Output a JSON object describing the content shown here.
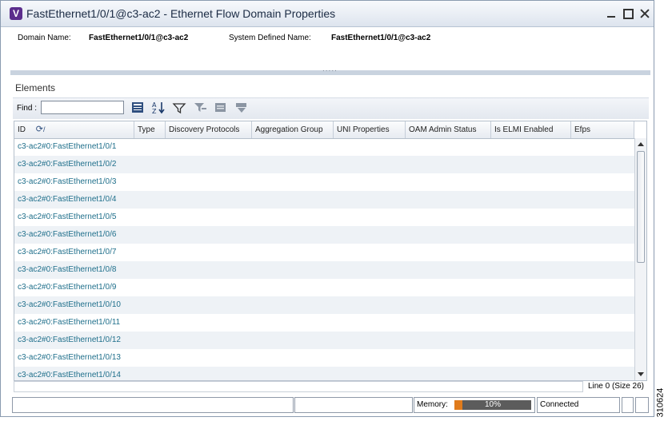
{
  "window": {
    "app_icon_letter": "V",
    "title": "FastEthernet1/0/1@c3-ac2 - Ethernet Flow Domain Properties"
  },
  "properties": {
    "domain_name_label": "Domain Name:",
    "domain_name_value": "FastEthernet1/0/1@c3-ac2",
    "system_name_label": "System Defined Name:",
    "system_name_value": "FastEthernet1/0/1@c3-ac2"
  },
  "elements": {
    "label": "Elements",
    "find_label": "Find :",
    "find_value": "",
    "toolbar_icons": [
      "export-icon",
      "sort-icon",
      "filter-icon",
      "advanced-filter-icon",
      "clear-filter-icon",
      "filter-options-icon"
    ],
    "columns": [
      "ID",
      "Type",
      "Discovery Protocols",
      "Aggregation Group",
      "UNI Properties",
      "OAM Admin Status",
      "Is ELMI Enabled",
      "Efps"
    ],
    "rows": [
      "c3-ac2#0:FastEthernet1/0/1",
      "c3-ac2#0:FastEthernet1/0/2",
      "c3-ac2#0:FastEthernet1/0/3",
      "c3-ac2#0:FastEthernet1/0/4",
      "c3-ac2#0:FastEthernet1/0/5",
      "c3-ac2#0:FastEthernet1/0/6",
      "c3-ac2#0:FastEthernet1/0/7",
      "c3-ac2#0:FastEthernet1/0/8",
      "c3-ac2#0:FastEthernet1/0/9",
      "c3-ac2#0:FastEthernet1/0/10",
      "c3-ac2#0:FastEthernet1/0/11",
      "c3-ac2#0:FastEthernet1/0/12",
      "c3-ac2#0:FastEthernet1/0/13",
      "c3-ac2#0:FastEthernet1/0/14"
    ],
    "line_info": "Line 0 (Size 26)"
  },
  "status": {
    "memory_label": "Memory:",
    "memory_percent": 10,
    "memory_text": "10%",
    "connection": "Connected"
  },
  "figure_id": "310624",
  "colors": {
    "link_text": "#1f6f8b",
    "memory_fill": "#e07b1c",
    "app_icon": "#5b2d8c"
  }
}
